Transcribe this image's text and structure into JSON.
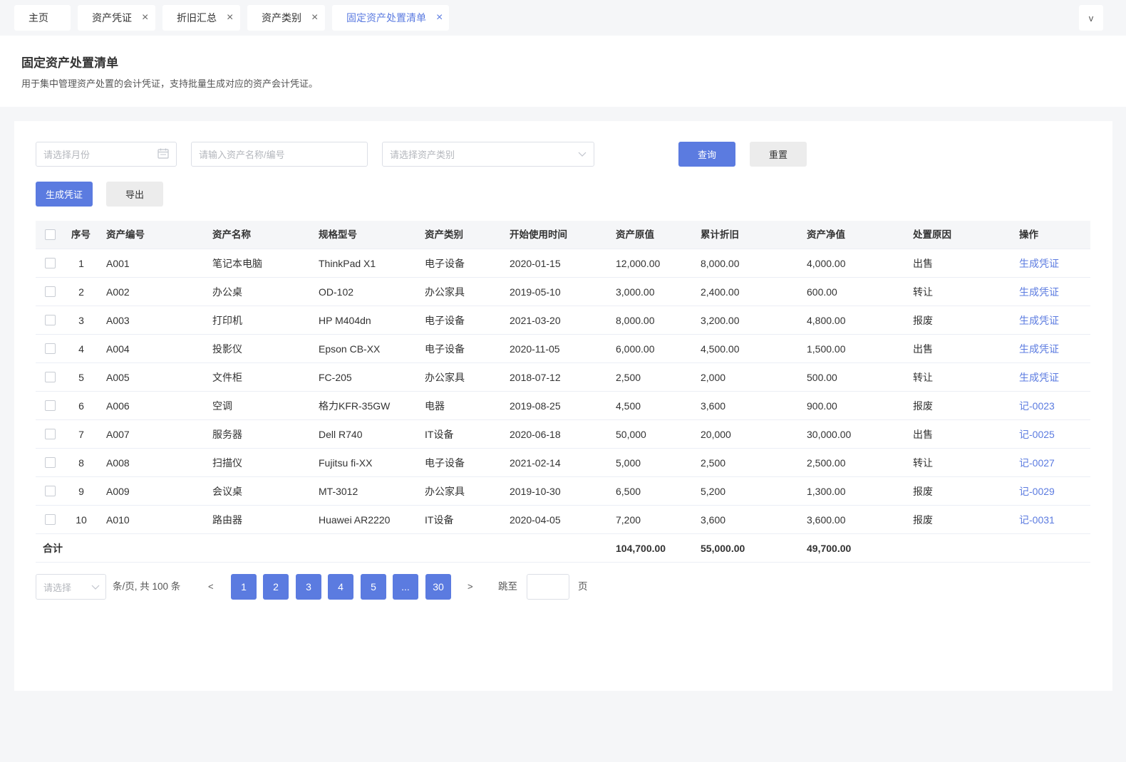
{
  "tabs": [
    {
      "label": "主页",
      "closable": false,
      "active": false
    },
    {
      "label": "资产凭证",
      "closable": true,
      "active": false
    },
    {
      "label": "折旧汇总",
      "closable": true,
      "active": false
    },
    {
      "label": "资产类别",
      "closable": true,
      "active": false
    },
    {
      "label": "固定资产处置清单",
      "closable": true,
      "active": true
    }
  ],
  "tab_close_glyph": "×",
  "tab_more_glyph": "v",
  "header": {
    "title": "固定资产处置清单",
    "description": "用于集中管理资产处置的会计凭证，支持批量生成对应的资产会计凭证。"
  },
  "filters": {
    "month_placeholder": "请选择月份",
    "asset_placeholder": "请输入资产名称/编号",
    "category_placeholder": "请选择资产类别",
    "query_label": "查询",
    "reset_label": "重置"
  },
  "actions": {
    "generate_label": "生成凭证",
    "export_label": "导出"
  },
  "table": {
    "columns": [
      "序号",
      "资产编号",
      "资产名称",
      "规格型号",
      "资产类别",
      "开始使用时间",
      "资产原值",
      "累计折旧",
      "资产净值",
      "处置原因",
      "操作"
    ],
    "rows": [
      {
        "no": "1",
        "code": "A001",
        "name": "笔记本电脑",
        "model": "ThinkPad X1",
        "category": "电子设备",
        "start": "2020-01-15",
        "original": "12,000.00",
        "depreciation": "8,000.00",
        "net": "4,000.00",
        "reason": "出售",
        "action": "生成凭证"
      },
      {
        "no": "2",
        "code": "A002",
        "name": "办公桌",
        "model": "OD-102",
        "category": "办公家具",
        "start": "2019-05-10",
        "original": "3,000.00",
        "depreciation": "2,400.00",
        "net": "600.00",
        "reason": "转让",
        "action": "生成凭证"
      },
      {
        "no": "3",
        "code": "A003",
        "name": "打印机",
        "model": "HP M404dn",
        "category": "电子设备",
        "start": "2021-03-20",
        "original": "8,000.00",
        "depreciation": "3,200.00",
        "net": "4,800.00",
        "reason": "报废",
        "action": "生成凭证"
      },
      {
        "no": "4",
        "code": "A004",
        "name": "投影仪",
        "model": "Epson CB-XX",
        "category": "电子设备",
        "start": "2020-11-05",
        "original": "6,000.00",
        "depreciation": "4,500.00",
        "net": "1,500.00",
        "reason": "出售",
        "action": "生成凭证"
      },
      {
        "no": "5",
        "code": "A005",
        "name": "文件柜",
        "model": "FC-205",
        "category": "办公家具",
        "start": "2018-07-12",
        "original": "2,500",
        "depreciation": "2,000",
        "net": "500.00",
        "reason": "转让",
        "action": "生成凭证"
      },
      {
        "no": "6",
        "code": "A006",
        "name": "空调",
        "model": "格力KFR-35GW",
        "category": "电器",
        "start": "2019-08-25",
        "original": "4,500",
        "depreciation": "3,600",
        "net": "900.00",
        "reason": "报废",
        "action": "记-0023"
      },
      {
        "no": "7",
        "code": "A007",
        "name": "服务器",
        "model": "Dell R740",
        "category": "IT设备",
        "start": "2020-06-18",
        "original": "50,000",
        "depreciation": "20,000",
        "net": "30,000.00",
        "reason": "出售",
        "action": "记-0025"
      },
      {
        "no": "8",
        "code": "A008",
        "name": "扫描仪",
        "model": "Fujitsu fi-XX",
        "category": "电子设备",
        "start": "2021-02-14",
        "original": "5,000",
        "depreciation": "2,500",
        "net": "2,500.00",
        "reason": "转让",
        "action": "记-0027"
      },
      {
        "no": "9",
        "code": "A009",
        "name": "会议桌",
        "model": "MT-3012",
        "category": "办公家具",
        "start": "2019-10-30",
        "original": "6,500",
        "depreciation": "5,200",
        "net": "1,300.00",
        "reason": "报废",
        "action": "记-0029"
      },
      {
        "no": "10",
        "code": "A010",
        "name": "路由器",
        "model": "Huawei AR2220",
        "category": "IT设备",
        "start": "2020-04-05",
        "original": "7,200",
        "depreciation": "3,600",
        "net": "3,600.00",
        "reason": "报废",
        "action": "记-0031"
      }
    ],
    "total": {
      "label": "合计",
      "original": "104,700.00",
      "depreciation": "55,000.00",
      "net": "49,700.00"
    }
  },
  "pagination": {
    "page_size_placeholder": "请选择",
    "total_text": "条/页, 共 100 条",
    "prev": "<",
    "next": ">",
    "pages": [
      "1",
      "2",
      "3",
      "4",
      "5",
      "...",
      "30"
    ],
    "jump_label": "跳至",
    "page_unit": "页"
  },
  "colors": {
    "accent": "#5b7be0",
    "background": "#f5f6f8"
  },
  "icons": {
    "month_field": "calendar-icon",
    "category_field": "chevron-down-icon",
    "page_size": "chevron-down-icon"
  }
}
